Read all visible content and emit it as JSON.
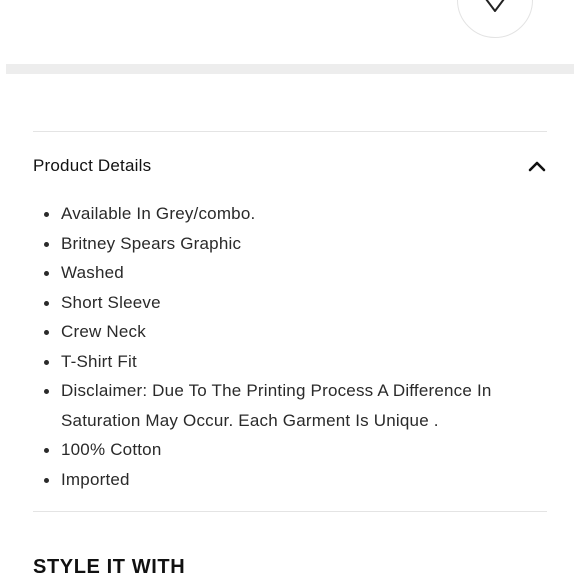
{
  "wishlist": {
    "icon": "heart-outline-icon"
  },
  "product_details": {
    "title": "Product Details",
    "toggle_icon": "chevron-up-icon",
    "items": [
      "Available In Grey/combo.",
      "Britney Spears Graphic",
      "Washed",
      "Short Sleeve",
      "Crew Neck",
      "T-Shirt Fit",
      "Disclaimer: Due To The Printing Process A Difference In Saturation May Occur. Each Garment Is Unique .",
      "100% Cotton",
      "Imported"
    ]
  },
  "style_it_with": {
    "heading": "STYLE IT WITH"
  }
}
